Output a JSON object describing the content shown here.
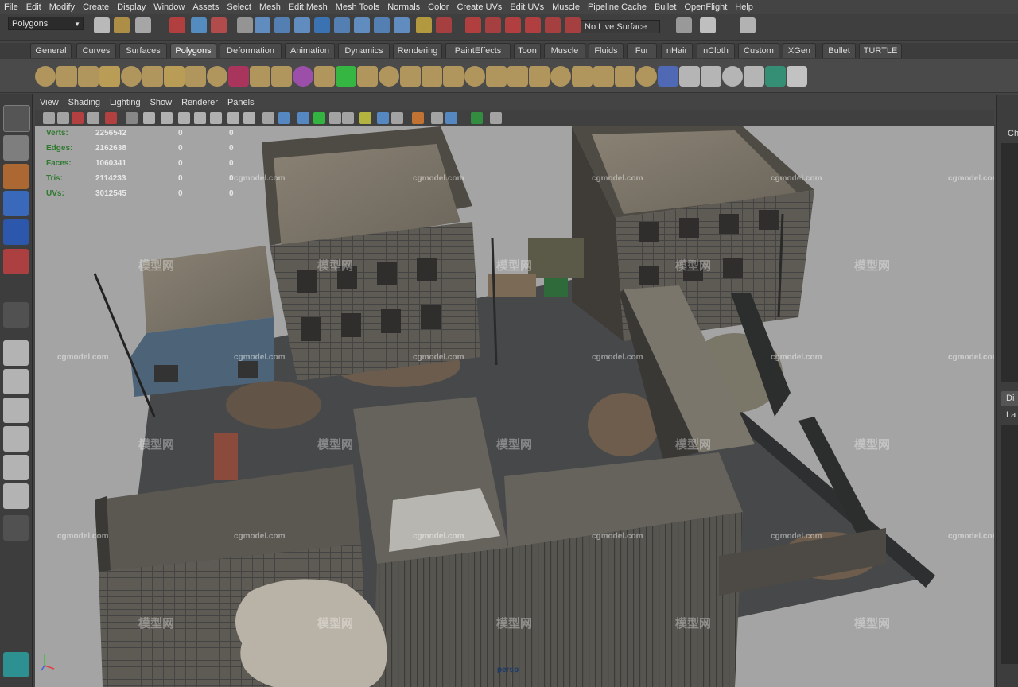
{
  "menubar": [
    "File",
    "Edit",
    "Modify",
    "Create",
    "Display",
    "Window",
    "Assets",
    "Select",
    "Mesh",
    "Edit Mesh",
    "Mesh Tools",
    "Normals",
    "Color",
    "Create UVs",
    "Edit UVs",
    "Muscle",
    "Pipeline Cache",
    "Bullet",
    "OpenFlight",
    "Help"
  ],
  "status_line": {
    "mode": "Polygons",
    "live_surface": "No Live Surface"
  },
  "shelf_tabs": [
    "General",
    "Curves",
    "Surfaces",
    "Polygons",
    "Deformation",
    "Animation",
    "Dynamics",
    "Rendering",
    "PaintEffects",
    "Toon",
    "Muscle",
    "Fluids",
    "Fur",
    "nHair",
    "nCloth",
    "Custom",
    "XGen",
    "Bullet",
    "TURTLE"
  ],
  "active_shelf_tab": "Polygons",
  "panel_menu": [
    "View",
    "Shading",
    "Lighting",
    "Show",
    "Renderer",
    "Panels"
  ],
  "hud": {
    "rows": [
      {
        "label": "Verts:",
        "v1": "2256542",
        "v2": "0",
        "v3": "0"
      },
      {
        "label": "Edges:",
        "v1": "2162638",
        "v2": "0",
        "v3": "0"
      },
      {
        "label": "Faces:",
        "v1": "1060341",
        "v2": "0",
        "v3": "0"
      },
      {
        "label": "Tris:",
        "v1": "2114233",
        "v2": "0",
        "v3": "0"
      },
      {
        "label": "UVs:",
        "v1": "3012545",
        "v2": "0",
        "v3": "0"
      }
    ]
  },
  "camera_label": "persp",
  "right_panel": {
    "top_label": "Ch",
    "tab_label": "Di",
    "sub_label": "La"
  },
  "watermark": {
    "text": "模型网",
    "site": "cgmodel.com"
  },
  "colors": {
    "viewport_bg": "#a4a4a4",
    "hud_label": "#2f7a2f",
    "ui_bg": "#444444",
    "active_tab": "#5a5a5a"
  }
}
